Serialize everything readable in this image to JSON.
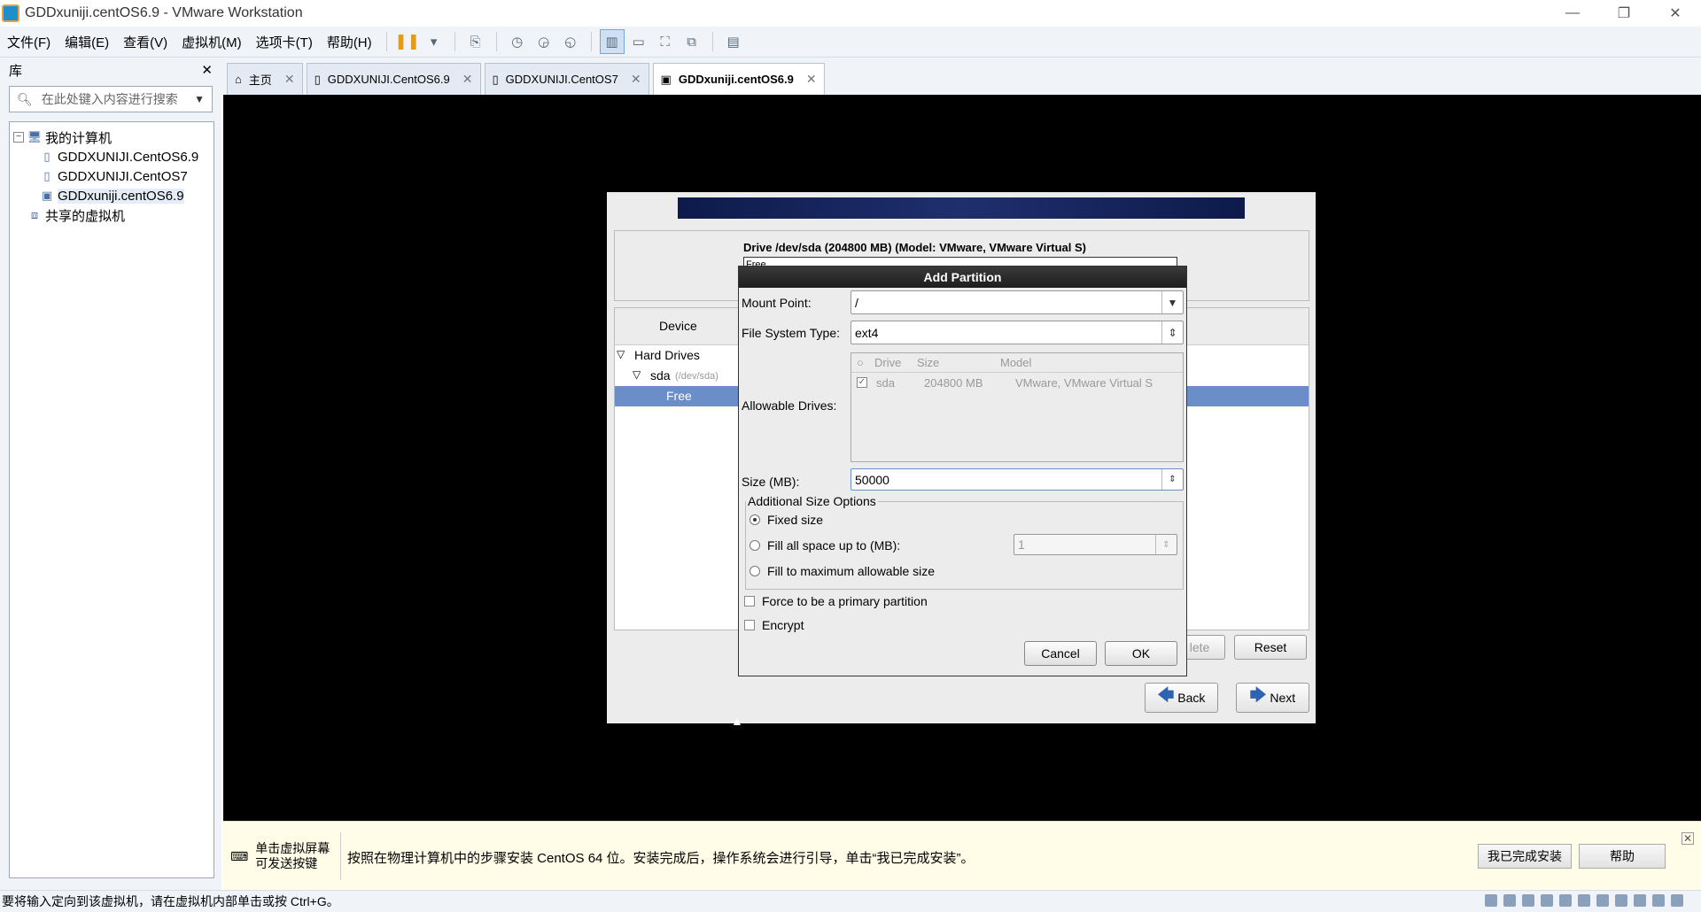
{
  "window": {
    "title": "GDDxuniji.centOS6.9 - VMware Workstation",
    "min_icon": "—",
    "restore_icon": "❐",
    "close_icon": "✕"
  },
  "menu": [
    "文件(F)",
    "编辑(E)",
    "查看(V)",
    "虚拟机(M)",
    "选项卡(T)",
    "帮助(H)"
  ],
  "library": {
    "title": "库",
    "close": "✕",
    "search_placeholder": "在此处键入内容进行搜索",
    "tree": {
      "root": "我的计算机",
      "vms": [
        "GDDXUNIJI.CentOS6.9",
        "GDDXUNIJI.CentOS7",
        "GDDxuniji.centOS6.9"
      ],
      "shared": "共享的虚拟机"
    }
  },
  "tabs": [
    {
      "label": "主页"
    },
    {
      "label": "GDDXUNIJI.CentOS6.9"
    },
    {
      "label": "GDDXUNIJI.CentOS7"
    },
    {
      "label": "GDDxuniji.centOS6.9"
    }
  ],
  "tab_close": "✕",
  "installer": {
    "drive_title": "Drive /dev/sda (204800 MB) (Model: VMware, VMware Virtual S)",
    "drive_bar_text": "Free",
    "device_header": "Device",
    "hard_drives": "Hard Drives",
    "sda": "sda",
    "sda_path": "(/dev/sda)",
    "free": "Free",
    "delete_label": "lete",
    "reset_label": "Reset",
    "back_label": "Back",
    "next_label": "Next"
  },
  "dialog": {
    "title": "Add Partition",
    "mount_point_label": "Mount Point:",
    "mount_point_value": "/",
    "fs_type_label": "File System Type:",
    "fs_type_value": "ext4",
    "allowable_drives_label": "Allowable Drives:",
    "drives_columns": [
      "Drive",
      "Size",
      "Model"
    ],
    "drives_rows": [
      {
        "drive": "sda",
        "size": "204800 MB",
        "model": "VMware, VMware Virtual S",
        "checked": true
      }
    ],
    "size_label": "Size (MB):",
    "size_value": "50000",
    "additional_label": "Additional Size Options",
    "opt_fixed": "Fixed size",
    "opt_fill_upto": "Fill all space up to (MB):",
    "fill_upto_value": "1",
    "opt_fill_max": "Fill to maximum allowable size",
    "selected_option": "fixed",
    "force_primary": "Force to be a primary partition",
    "encrypt": "Encrypt",
    "cancel": "Cancel",
    "ok": "OK"
  },
  "notification": {
    "hint_line1": "单击虚拟屏幕",
    "hint_line2": "可发送按键",
    "message": "按照在物理计算机中的步骤安装 CentOS 64 位。安装完成后，操作系统会进行引导，单击“我已完成安装”。",
    "done_button": "我已完成安装",
    "help_button": "帮助",
    "close": "✕"
  },
  "status_bar": "要将输入定向到该虚拟机，请在虚拟机内部单击或按 Ctrl+G。",
  "colors": {
    "selection": "#6b8ec9",
    "banner": "#1f2f6e",
    "notification_bg": "#fffde8"
  }
}
